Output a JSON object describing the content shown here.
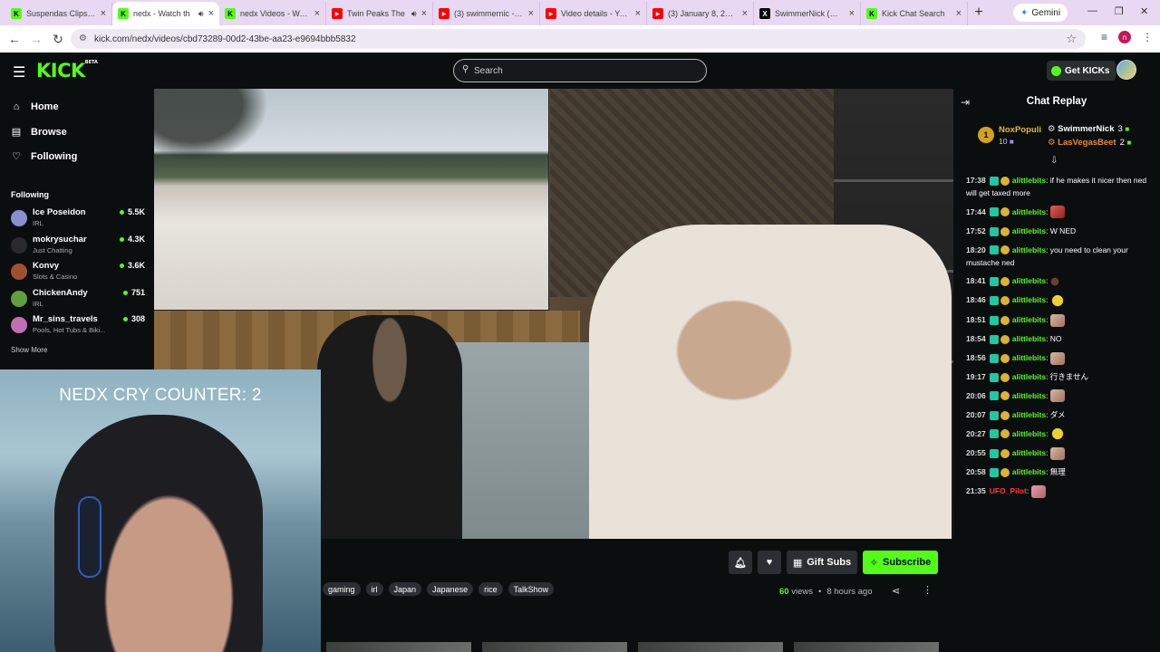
{
  "browser": {
    "tabs": [
      {
        "title": "Suspendas Clips - W",
        "icon": "kick-icon",
        "color": "#53fc18"
      },
      {
        "title": "nedx - Watch th",
        "icon": "kick-icon",
        "color": "#53fc18",
        "active": true,
        "audio": true
      },
      {
        "title": "nedx Videos - Watc",
        "icon": "kick-icon",
        "color": "#53fc18"
      },
      {
        "title": "Twin Peaks The",
        "icon": "youtube-icon",
        "color": "#ff0000",
        "audio": true
      },
      {
        "title": "(3) swimmernic - Yo",
        "icon": "youtube-icon",
        "color": "#ff0000"
      },
      {
        "title": "Video details - YouT",
        "icon": "youtube-icon",
        "color": "#ff0000"
      },
      {
        "title": "(3) January 8, 2026",
        "icon": "youtube-icon",
        "color": "#ff0000"
      },
      {
        "title": "SwimmerNick (@Ke",
        "icon": "x-icon",
        "color": "#000000"
      },
      {
        "title": "Kick Chat Search",
        "icon": "kick-icon",
        "color": "#53fc18"
      }
    ],
    "gemini_label": "Gemini",
    "url": "kick.com/nedx/videos/cbd73289-00d2-43be-aa23-e9694bbb5832",
    "profile_letter": "n"
  },
  "header": {
    "logo": "KICK",
    "logo_badge": "BETA",
    "search_placeholder": "Search",
    "get_kicks": "Get KICKs"
  },
  "sidebar": {
    "nav": [
      {
        "label": "Home",
        "icon": "home-icon"
      },
      {
        "label": "Browse",
        "icon": "browse-icon"
      },
      {
        "label": "Following",
        "icon": "heart-icon"
      }
    ],
    "following_header": "Following",
    "following": [
      {
        "name": "Ice Poseidon",
        "category": "IRL",
        "viewers": "5.5K",
        "color": "#8a8fd0"
      },
      {
        "name": "mokrysuchar",
        "category": "Just Chatting",
        "viewers": "4.3K",
        "color": "#2a2a2a"
      },
      {
        "name": "Konvy",
        "category": "Slots & Casino",
        "viewers": "3.6K",
        "color": "#a05030"
      },
      {
        "name": "ChickenAndy",
        "category": "IRL",
        "viewers": "751",
        "color": "#60a040"
      },
      {
        "name": "Mr_sins_travels",
        "category": "Pools, Hot Tubs & Biki...",
        "viewers": "308",
        "color": "#c070b0"
      }
    ],
    "show_more": "Show More"
  },
  "video": {
    "overlay_text": "NEDX CRY COUNTER: 2"
  },
  "actions": {
    "gift_subs": "Gift Subs",
    "subscribe": "Subscribe"
  },
  "tags": [
    "gaming",
    "irl",
    "Japan",
    "Japanese",
    "rice",
    "TalkShow"
  ],
  "meta": {
    "views_count": "60",
    "views_label": "views",
    "bullet": "•",
    "age": "8 hours ago"
  },
  "chat": {
    "title": "Chat Replay",
    "top_gifters": [
      {
        "rank": "1",
        "name": "NoxPopuli",
        "count": "10"
      },
      {
        "name": "SwimmerNick",
        "count": "3"
      },
      {
        "name": "LasVegasBeet",
        "count": "2"
      }
    ],
    "messages": [
      {
        "time": "17:38",
        "user": "alittlebits",
        "text": "if he makes it nicer then ned will get taxed more"
      },
      {
        "time": "17:44",
        "user": "alittlebits",
        "text": "",
        "emote": "red"
      },
      {
        "time": "17:52",
        "user": "alittlebits",
        "text": "W NED"
      },
      {
        "time": "18:20",
        "user": "alittlebits",
        "text": "you need to clean your mustache ned"
      },
      {
        "time": "18:41",
        "user": "alittlebits",
        "text": "",
        "emote": "tiny"
      },
      {
        "time": "18:46",
        "user": "alittlebits",
        "text": "",
        "emote": "yel"
      },
      {
        "time": "18:51",
        "user": "alittlebits",
        "text": "",
        "emote": "face"
      },
      {
        "time": "18:54",
        "user": "alittlebits",
        "text": "NO"
      },
      {
        "time": "18:56",
        "user": "alittlebits",
        "text": "",
        "emote": "face"
      },
      {
        "time": "19:17",
        "user": "alittlebits",
        "text": "行きません"
      },
      {
        "time": "20:06",
        "user": "alittlebits",
        "text": "",
        "emote": "face"
      },
      {
        "time": "20:07",
        "user": "alittlebits",
        "text": "ダメ"
      },
      {
        "time": "20:27",
        "user": "alittlebits",
        "text": "",
        "emote": "yel"
      },
      {
        "time": "20:55",
        "user": "alittlebits",
        "text": "",
        "emote": "face"
      },
      {
        "time": "20:58",
        "user": "alittlebits",
        "text": "無理"
      },
      {
        "time": "21:35",
        "user": "UFO_Pilot",
        "text": "",
        "emote": "pink",
        "red": true
      }
    ]
  },
  "colors": {
    "accent": "#53fc18",
    "background": "#0b0e0f"
  }
}
